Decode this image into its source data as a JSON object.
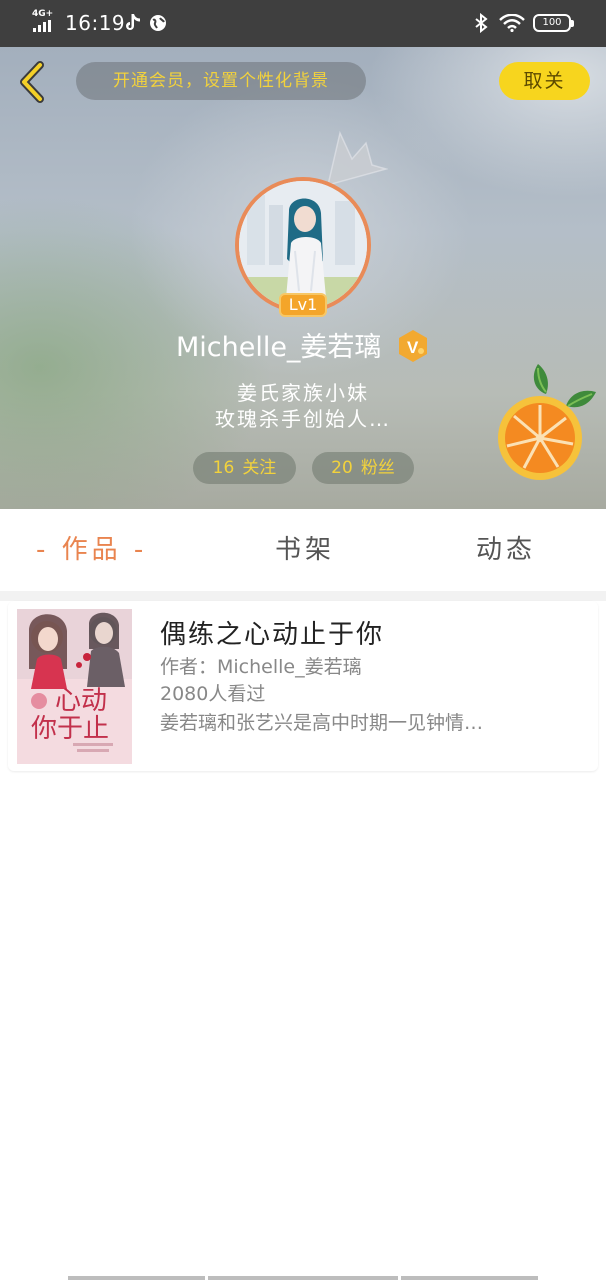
{
  "status_bar": {
    "network": "4G+",
    "time": "16:19",
    "battery": "100"
  },
  "header": {
    "vip_banner": "开通会员，设置个性化背景",
    "unfollow_label": "取关",
    "level": "Lv1",
    "username": "Michelle_姜若璃",
    "verified_badge": "V",
    "bio_lines": [
      "姜氏家族小妹",
      "玫瑰杀手创始人…"
    ],
    "following": {
      "count": "16",
      "label": "关注"
    },
    "fans": {
      "count": "20",
      "label": "粉丝"
    }
  },
  "tabs": {
    "works": "- 作品 -",
    "shelf": "书架",
    "feed": "动态"
  },
  "book": {
    "title": "偶练之心动止于你",
    "author": "作者：Michelle_姜若璃",
    "views": "2080人看过",
    "description": "姜若璃和张艺兴是高中时期一见钟情…",
    "cover_text": "心动 你于止"
  },
  "colors": {
    "status_bar": "#3f3f3f",
    "accent_yellow": "#f7d51e",
    "accent_orange": "#e9844f",
    "avatar_border": "#e98b58",
    "level_badge": "#f4a52a"
  },
  "icons": [
    "back-arrow-icon",
    "crown-icon",
    "verified-icon",
    "orange-icon",
    "bluetooth-icon",
    "wifi-icon",
    "battery-icon",
    "tiktok-icon",
    "globe-icon",
    "signal-icon"
  ]
}
